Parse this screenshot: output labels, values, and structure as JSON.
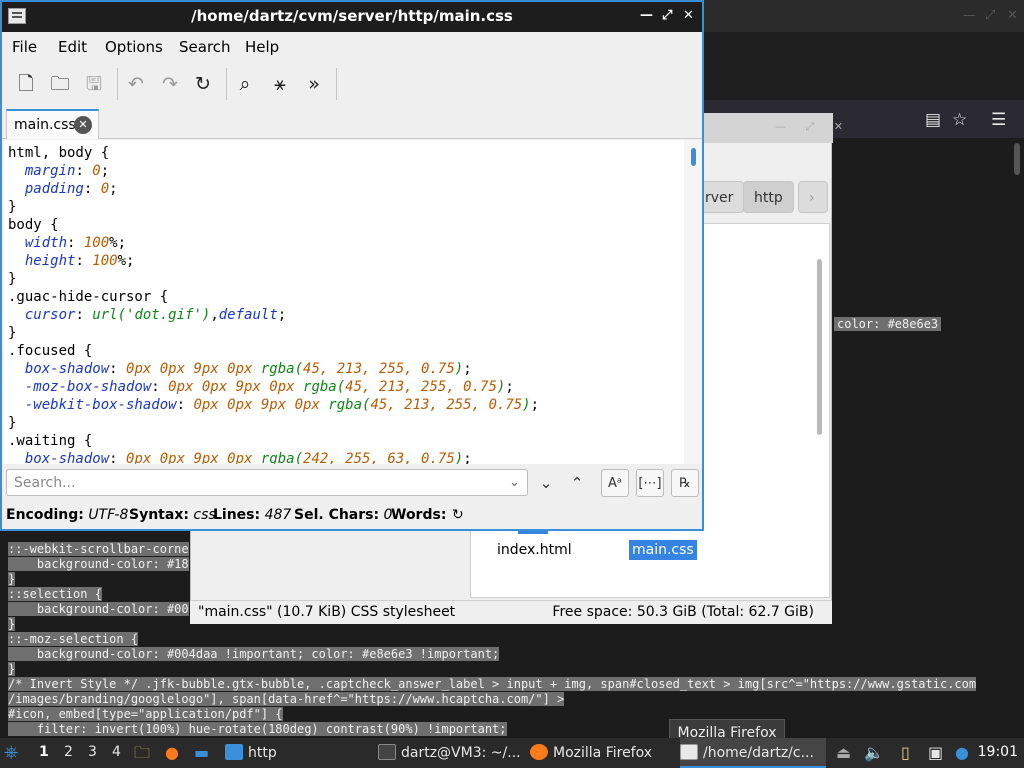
{
  "editor": {
    "title": "/home/dartz/cvm/server/http/main.css",
    "window_controls": {
      "minimize": "—",
      "maximize": "⤢",
      "close": "✕"
    },
    "menu": [
      "File",
      "Edit",
      "Options",
      "Search",
      "Help"
    ],
    "tab_label": "main.css",
    "code_lines": [
      [
        [
          "k",
          "html, body {"
        ]
      ],
      [
        [
          "k",
          "  "
        ],
        [
          "p",
          "margin"
        ],
        [
          "k",
          ": "
        ],
        [
          "n",
          "0"
        ],
        [
          "k",
          ";"
        ]
      ],
      [
        [
          "k",
          "  "
        ],
        [
          "p",
          "padding"
        ],
        [
          "k",
          ": "
        ],
        [
          "n",
          "0"
        ],
        [
          "k",
          ";"
        ]
      ],
      [
        [
          "k",
          "}"
        ]
      ],
      [
        [
          "k",
          "body {"
        ]
      ],
      [
        [
          "k",
          "  "
        ],
        [
          "p",
          "width"
        ],
        [
          "k",
          ": "
        ],
        [
          "n",
          "100"
        ],
        [
          "k",
          "%;"
        ]
      ],
      [
        [
          "k",
          "  "
        ],
        [
          "p",
          "height"
        ],
        [
          "k",
          ": "
        ],
        [
          "n",
          "100"
        ],
        [
          "k",
          "%;"
        ]
      ],
      [
        [
          "k",
          "}"
        ]
      ],
      [
        [
          "k",
          ".guac-hide-cursor {"
        ]
      ],
      [
        [
          "k",
          "  "
        ],
        [
          "p",
          "cursor"
        ],
        [
          "k",
          ": "
        ],
        [
          "f",
          "url('dot.gif')"
        ],
        [
          "k",
          ","
        ],
        [
          "p",
          "default"
        ],
        [
          "k",
          ";"
        ]
      ],
      [
        [
          "k",
          "}"
        ]
      ],
      [
        [
          "k",
          ".focused {"
        ]
      ],
      [
        [
          "k",
          "  "
        ],
        [
          "p",
          "box-shadow"
        ],
        [
          "k",
          ": "
        ],
        [
          "n",
          "0px 0px 9px 0px "
        ],
        [
          "f",
          "rgba("
        ],
        [
          "n",
          "45, 213, 255, 0.75"
        ],
        [
          "f",
          ")"
        ],
        [
          "k",
          ";"
        ]
      ],
      [
        [
          "k",
          "  "
        ],
        [
          "p",
          "-moz-box-shadow"
        ],
        [
          "k",
          ": "
        ],
        [
          "n",
          "0px 0px 9px 0px "
        ],
        [
          "f",
          "rgba("
        ],
        [
          "n",
          "45, 213, 255, 0.75"
        ],
        [
          "f",
          ")"
        ],
        [
          "k",
          ";"
        ]
      ],
      [
        [
          "k",
          "  "
        ],
        [
          "p",
          "-webkit-box-shadow"
        ],
        [
          "k",
          ": "
        ],
        [
          "n",
          "0px 0px 9px 0px "
        ],
        [
          "f",
          "rgba("
        ],
        [
          "n",
          "45, 213, 255, 0.75"
        ],
        [
          "f",
          ")"
        ],
        [
          "k",
          ";"
        ]
      ],
      [
        [
          "k",
          "}"
        ]
      ],
      [
        [
          "k",
          ".waiting {"
        ]
      ],
      [
        [
          "k",
          "  "
        ],
        [
          "p",
          "box-shadow"
        ],
        [
          "k",
          ": "
        ],
        [
          "n",
          "0px 0px 9px 0px "
        ],
        [
          "f",
          "rgba("
        ],
        [
          "n",
          "242, 255, 63, 0.75"
        ],
        [
          "f",
          ")"
        ],
        [
          "k",
          ";"
        ]
      ]
    ],
    "search_placeholder": "Search...",
    "status": {
      "encoding_label": "Encoding:",
      "encoding": "UTF-8",
      "syntax_label": "Syntax:",
      "syntax": "css",
      "lines_label": "Lines:",
      "lines": "487",
      "sel_label": "Sel. Chars:",
      "sel": "0",
      "words_label": "Words:"
    }
  },
  "file_manager": {
    "crumbs": [
      "rver",
      "http"
    ],
    "files": [
      "index.html",
      "main.css"
    ],
    "status_left": "\"main.css\" (10.7 KiB) CSS stylesheet",
    "status_right": "Free space: 50.3 GiB (Total: 62.7 GiB)"
  },
  "terminal": {
    "color_label": "color: #e8e6e3",
    "lines": [
      "::-webkit-scrollbar-corne",
      "    background-color: #18",
      "}",
      "::selection {",
      "    background-color: #00",
      "}",
      "::-moz-selection {",
      "    background-color: #004daa !important; color: #e8e6e3 !important;",
      "}",
      "/* Invert Style */ .jfk-bubble.gtx-bubble, .captcheck_answer_label > input + img, span#closed_text > img[src^=\"https://www.gstatic.com",
      "/images/branding/googlelogo\"], span[data-href^=\"https://www.hcaptcha.com/\"] >",
      "#icon, embed[type=\"application/pdf\"] {",
      "    filter: invert(100%) hue-rotate(180deg) contrast(90%) !important;"
    ]
  },
  "tooltip": "Mozilla Firefox",
  "taskbar": {
    "workspaces": [
      "1",
      "2",
      "3",
      "4"
    ],
    "tasks": [
      "http",
      "dartz@VM3: ~/...",
      "Mozilla Firefox",
      "/home/dartz/c..."
    ],
    "clock": "19:01"
  }
}
